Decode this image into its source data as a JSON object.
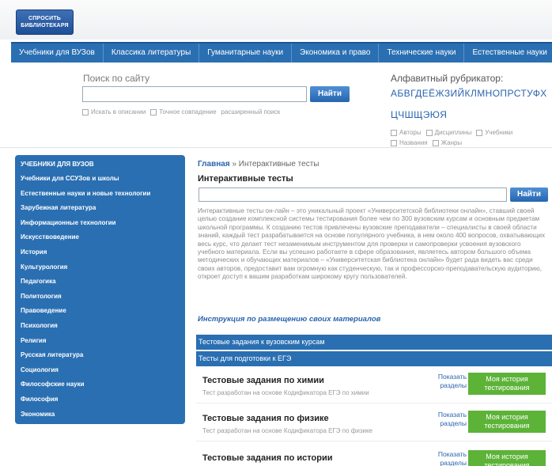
{
  "logo": {
    "line1": "СПРОСИТЬ",
    "line2": "БИБЛИОТЕКАРЯ"
  },
  "nav": [
    "Учебники для ВУЗов",
    "Классика литературы",
    "Гуманитарные науки",
    "Экономика и право",
    "Технические науки",
    "Естественные науки"
  ],
  "search": {
    "title": "Поиск по сайту",
    "button": "Найти",
    "opt1": "Искать в описании",
    "opt2": "Точное совпадение",
    "advanced": "расширенный поиск"
  },
  "alphabet": {
    "title": "Алфавитный рубрикатор:",
    "row1": "АБВГДЕЁЖЗИЙКЛМНОПРСТУФХ",
    "row2": "ЦЧШЩЭЮЯ",
    "opts1": [
      "Авторы",
      "Дисциплины",
      "Учебники"
    ],
    "opts2": [
      "Названия",
      "Жанры"
    ]
  },
  "sidebar": {
    "header": "УЧЕБНИКИ ДЛЯ ВУЗОВ",
    "items": [
      "Учебники для ССУЗов и школы",
      "Естественные науки и новые технологии",
      "Зарубежная литература",
      "Информационные технологии",
      "Искусствоведение",
      "История",
      "Культурология",
      "Педагогика",
      "Политология",
      "Правоведение",
      "Психология",
      "Религия",
      "Русская литература",
      "Социология",
      "Философские науки",
      "Философия",
      "Экономика"
    ]
  },
  "breadcrumb": {
    "home": "Главная",
    "sep": "»",
    "current": "Интерактивные тесты"
  },
  "main": {
    "title": "Интерактивные тесты",
    "button": "Найти",
    "description": "Интерактивные тесты он-лайн – это уникальный проект «Университетской библиотеки онлайн», ставший своей целью создание комплексной системы тестирования более чем по 300 вузовским курсам и основным предметам школьной программы. К созданию тестов привлечены вузовские преподаватели – специалисты в своей области знаний, каждый тест разрабатывается на основе популярного учебника, в нем около 400 вопросов, охватывающих весь курс, что делает тест незаменимым инструментом для проверки и самопроверки усвоения вузовского учебного материала. Если вы успешно работаете в сфере образования, являетесь автором большого объема методических и обучающих материалов – «Университетская библиотека онлайн» будет рада видеть вас среди своих авторов, предоставит вам огромную как студенческую, так и профессорско-преподавательскую аудиторию, откроет доступ к вашим разработкам широкому кругу пользователей.",
    "instruction": "Инструкция по размещению своих материалов",
    "bar1": "Тестовые задания к вузовским курсам",
    "bar2": "Тесты для подготовки к ЕГЭ"
  },
  "tests": [
    {
      "title": "Тестовые задания по химии",
      "subtitle": "Тест разработан на основе Кодификатора ЕГЭ по химии",
      "show": "Показать разделы",
      "history": "Моя история тестирования"
    },
    {
      "title": "Тестовые задания по физике",
      "subtitle": "Тест разработан на основе Кодификатора ЕГЭ по физике",
      "show": "Показать разделы",
      "history": "Моя история тестирования"
    },
    {
      "title": "Тестовые задания по истории",
      "subtitle": "",
      "show": "Показать разделы",
      "history": "Моя история тестирования"
    }
  ]
}
